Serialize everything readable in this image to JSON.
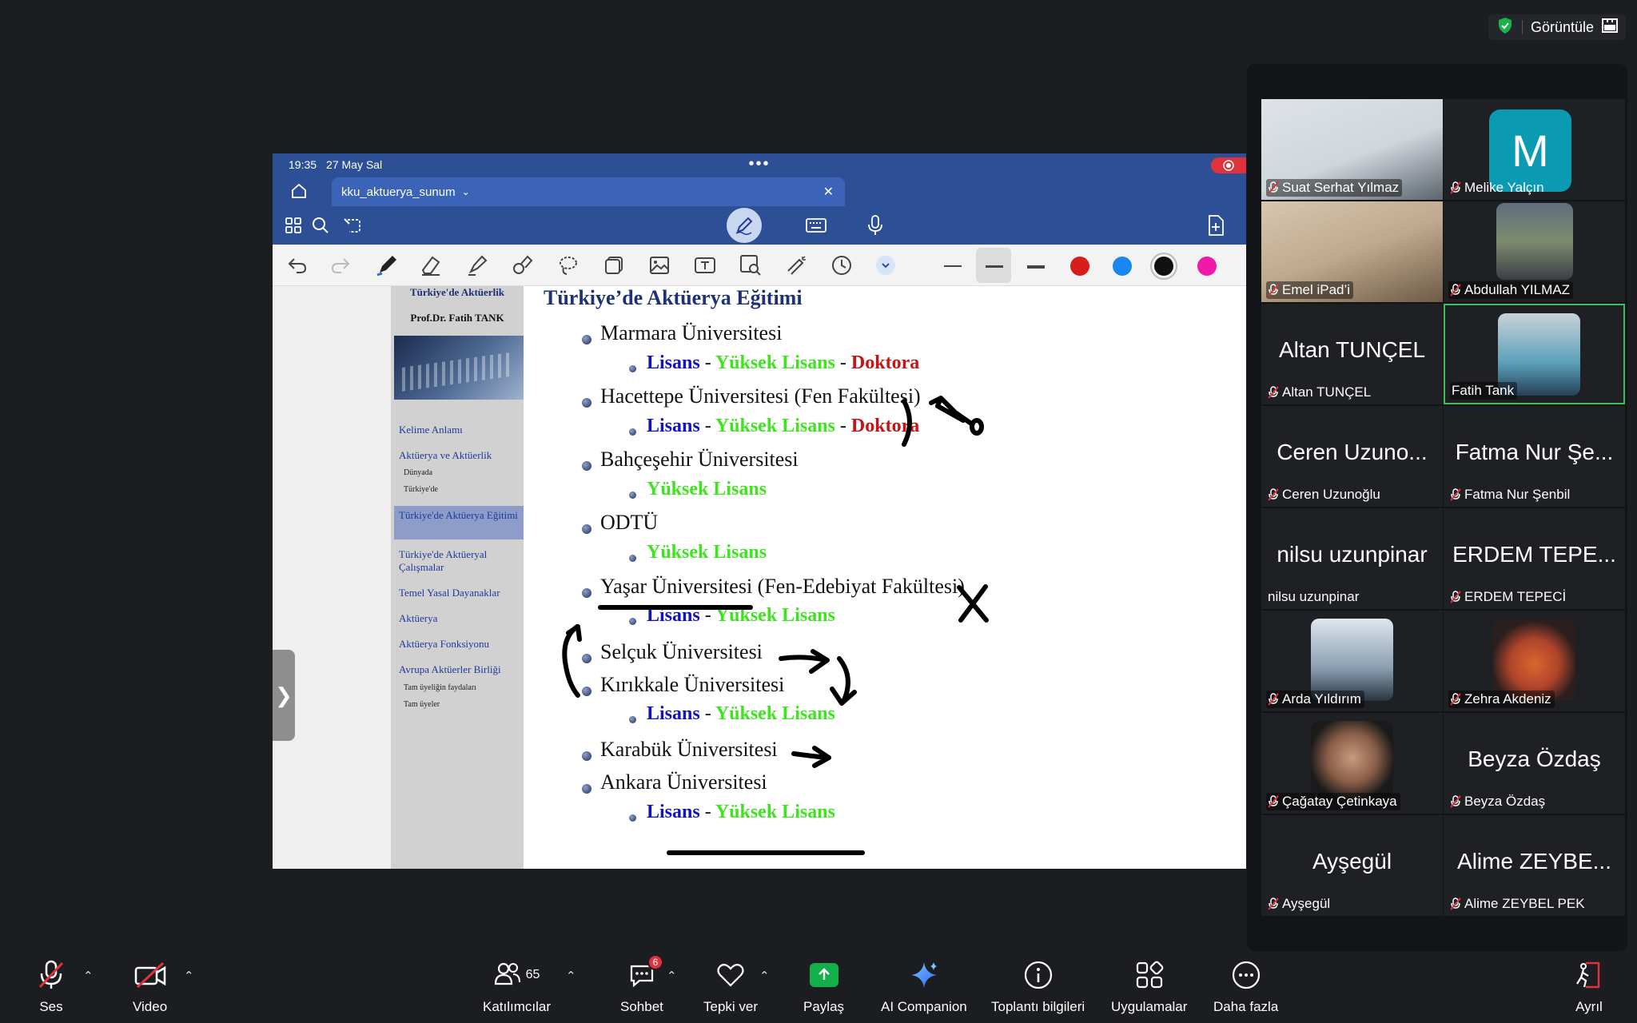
{
  "view_control": {
    "label": "Görüntüle"
  },
  "ipad": {
    "time": "19:35",
    "date": "27 May Sal",
    "tab_title": "kku_aktuerya_sunum"
  },
  "slide": {
    "nav_title": "Türkiye'de Aktüerlik",
    "nav_author": "Prof.Dr. Fatih TANK",
    "nav_items": [
      "Kelime Anlamı",
      "Aktüerya ve Aktüerlik",
      "Türkiye'de Aktüerya Eğitimi",
      "Türkiye'de Aktüeryal Çalışmalar",
      "Temel Yasal Dayanaklar",
      "Aktüerya",
      "Aktüerya Fonksiyonu",
      "Avrupa Aktüerler Birliği"
    ],
    "nav_subitems": [
      "Dünyada",
      "Türkiye'de",
      "Tam üyeliğin faydaları",
      "Tam üyeler"
    ],
    "title": "Türkiye’de Aktüerya Eğitimi",
    "universities": [
      "Marmara Üniversitesi",
      "Hacettepe Üniversitesi (Fen Fakültesi)",
      "Bahçeşehir Üniversitesi",
      "ODTÜ",
      "Yaşar Üniversitesi (Fen-Edebiyat Fakültesi)",
      "Selçuk Üniversitesi",
      "Kırıkkale Üniversitesi",
      "Karabük Üniversitesi",
      "Ankara Üniversitesi"
    ],
    "degrees": {
      "lisans": "Lisans",
      "yuksek_lisans": "Yüksek Lisans",
      "doktora": "Doktora",
      "sep": "-"
    }
  },
  "participants": [
    {
      "name": "Suat Serhat Yılmaz",
      "display": "",
      "video": true
    },
    {
      "name": "Melike Yalçın",
      "display": "M",
      "video": false
    },
    {
      "name": "Emel iPad’i",
      "display": "",
      "video": true
    },
    {
      "name": "Abdullah YILMAZ",
      "display": "",
      "video": true
    },
    {
      "name": "Altan TUNÇEL",
      "display": "Altan TUNÇEL",
      "video": false
    },
    {
      "name": "Fatih Tank",
      "display": "",
      "video": true
    },
    {
      "name": "Ceren Uzunoğlu",
      "display": "Ceren Uzuno...",
      "video": false
    },
    {
      "name": "Fatma Nur Şenbil",
      "display": "Fatma Nur Şe...",
      "video": false
    },
    {
      "name": "nilsu uzunpinar",
      "display": "nilsu uzunpinar",
      "video": false
    },
    {
      "name": "ERDEM TEPECİ",
      "display": "ERDEM TEPE...",
      "video": false
    },
    {
      "name": "Arda Yıldırım",
      "display": "",
      "video": true
    },
    {
      "name": "Zehra Akdeniz",
      "display": "",
      "video": true
    },
    {
      "name": "Çağatay Çetinkaya",
      "display": "",
      "video": true
    },
    {
      "name": "Beyza Özdaş",
      "display": "Beyza Özdaş",
      "video": false
    },
    {
      "name": "Ayşegül",
      "display": "Ayşegül",
      "video": false
    },
    {
      "name": "Alime ZEYBEL PEK",
      "display": "Alime ZEYBE...",
      "video": false
    }
  ],
  "bottom_bar": {
    "audio": "Ses",
    "video": "Video",
    "participants": "Katılımcılar",
    "participant_count": "65",
    "chat": "Sohbet",
    "chat_badge": "6",
    "react": "Tepki ver",
    "share": "Paylaş",
    "ai": "AI Companion",
    "info": "Toplantı bilgileri",
    "apps": "Uygulamalar",
    "more": "Daha fazla",
    "leave": "Ayrıl"
  },
  "colors": {
    "lisans": "#1212c4",
    "yuksek_lisans": "#3ee41e",
    "doktora": "#c81414",
    "ribbon": "#2d4f96",
    "active_speaker": "#3bbf5a"
  }
}
